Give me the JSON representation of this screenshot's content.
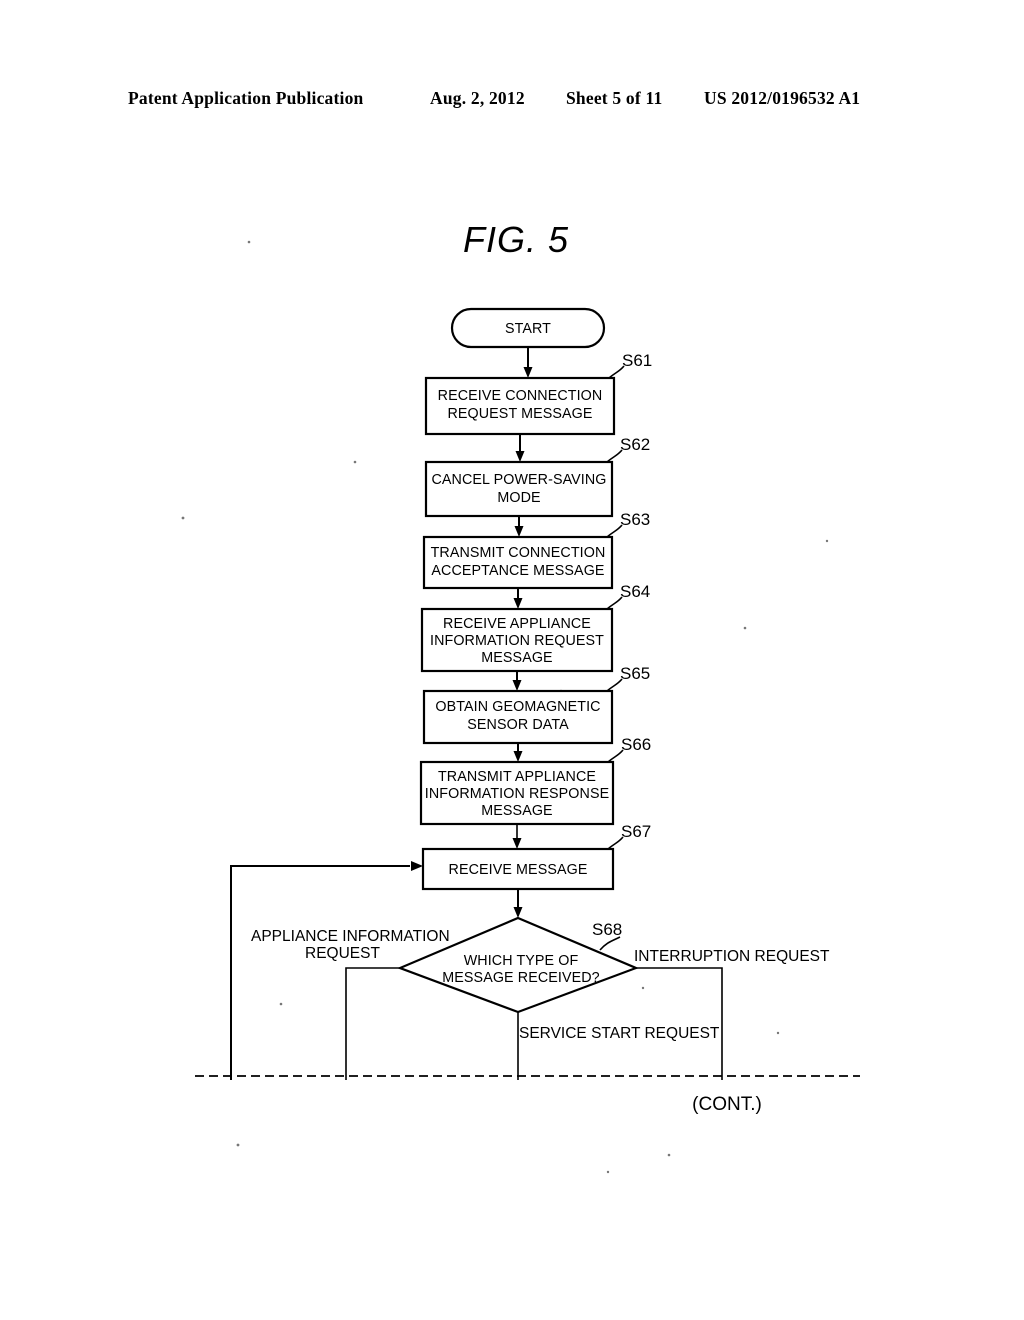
{
  "header": {
    "publication": "Patent Application Publication",
    "date": "Aug. 2, 2012",
    "sheet": "Sheet 5 of 11",
    "number": "US 2012/0196532 A1"
  },
  "figure": {
    "title": "FIG. 5",
    "continuation": "(CONT.)",
    "terminal": {
      "label": "START"
    },
    "steps": [
      {
        "id": "S61",
        "lines": [
          "RECEIVE CONNECTION",
          "REQUEST MESSAGE"
        ]
      },
      {
        "id": "S62",
        "lines": [
          "CANCEL POWER-SAVING",
          "MODE"
        ]
      },
      {
        "id": "S63",
        "lines": [
          "TRANSMIT CONNECTION",
          "ACCEPTANCE MESSAGE"
        ]
      },
      {
        "id": "S64",
        "lines": [
          "RECEIVE APPLIANCE",
          "INFORMATION REQUEST",
          "MESSAGE"
        ]
      },
      {
        "id": "S65",
        "lines": [
          "OBTAIN GEOMAGNETIC",
          "SENSOR DATA"
        ]
      },
      {
        "id": "S66",
        "lines": [
          "TRANSMIT APPLIANCE",
          "INFORMATION RESPONSE",
          "MESSAGE"
        ]
      },
      {
        "id": "S67",
        "lines": [
          "RECEIVE MESSAGE"
        ]
      }
    ],
    "decision": {
      "id": "S68",
      "lines": [
        "WHICH TYPE OF",
        "MESSAGE RECEIVED?"
      ],
      "branches": [
        {
          "name": "left",
          "lines": [
            "APPLIANCE INFORMATION",
            "REQUEST"
          ]
        },
        {
          "name": "bottom",
          "lines": [
            "SERVICE START REQUEST"
          ]
        },
        {
          "name": "right",
          "lines": [
            "INTERRUPTION REQUEST"
          ]
        }
      ]
    }
  },
  "colors": {
    "ink": "#000000",
    "paper": "#ffffff"
  }
}
